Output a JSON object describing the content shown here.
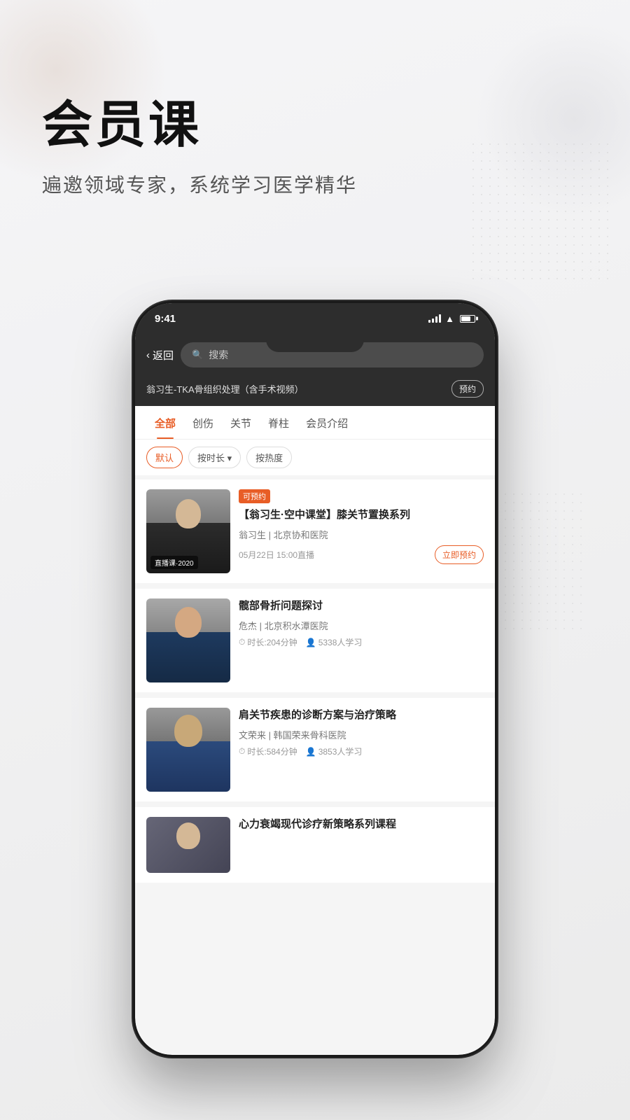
{
  "page": {
    "background": "#f0f0f0"
  },
  "header": {
    "title": "会员课",
    "subtitle": "遍邀领域专家，系统学习医学精华"
  },
  "phone": {
    "status_bar": {
      "time": "9:41"
    },
    "nav": {
      "back_label": "返回",
      "search_placeholder": "搜索"
    },
    "sub_nav": {
      "title": "翁习生-TKA骨组织处理（含手术视频）",
      "button_label": "预约"
    },
    "tabs": [
      {
        "label": "全部",
        "active": true
      },
      {
        "label": "创伤",
        "active": false
      },
      {
        "label": "关节",
        "active": false
      },
      {
        "label": "脊柱",
        "active": false
      },
      {
        "label": "会员介绍",
        "active": false
      }
    ],
    "filters": [
      {
        "label": "默认",
        "active": true
      },
      {
        "label": "按时长 ▾",
        "active": false
      },
      {
        "label": "按热度",
        "active": false
      }
    ],
    "courses": [
      {
        "id": 1,
        "badge": "可预约",
        "title": "【翁习生·空中课堂】膝关节置换系列",
        "author": "翁习生 | 北京协和医院",
        "date": "05月22日 15:00直播",
        "thumb_label": "直播课·2020",
        "action_label": "立即预约",
        "person_class": "person-1"
      },
      {
        "id": 2,
        "badge": "",
        "title": "髋部骨折问题探讨",
        "author": "危杰 | 北京积水潭医院",
        "duration": "时长:204分钟",
        "learners": "5338人学习",
        "person_class": "person-2"
      },
      {
        "id": 3,
        "badge": "",
        "title": "肩关节疾患的诊断方案与治疗策略",
        "author": "文荣来 | 韩国荣来骨科医院",
        "duration": "时长:584分钟",
        "learners": "3853人学习",
        "person_class": "person-3"
      },
      {
        "id": 4,
        "badge": "",
        "title": "心力衰竭现代诊疗新策略系列课程",
        "author": "",
        "duration": "",
        "learners": "",
        "person_class": "person-4",
        "partial": true
      }
    ]
  }
}
